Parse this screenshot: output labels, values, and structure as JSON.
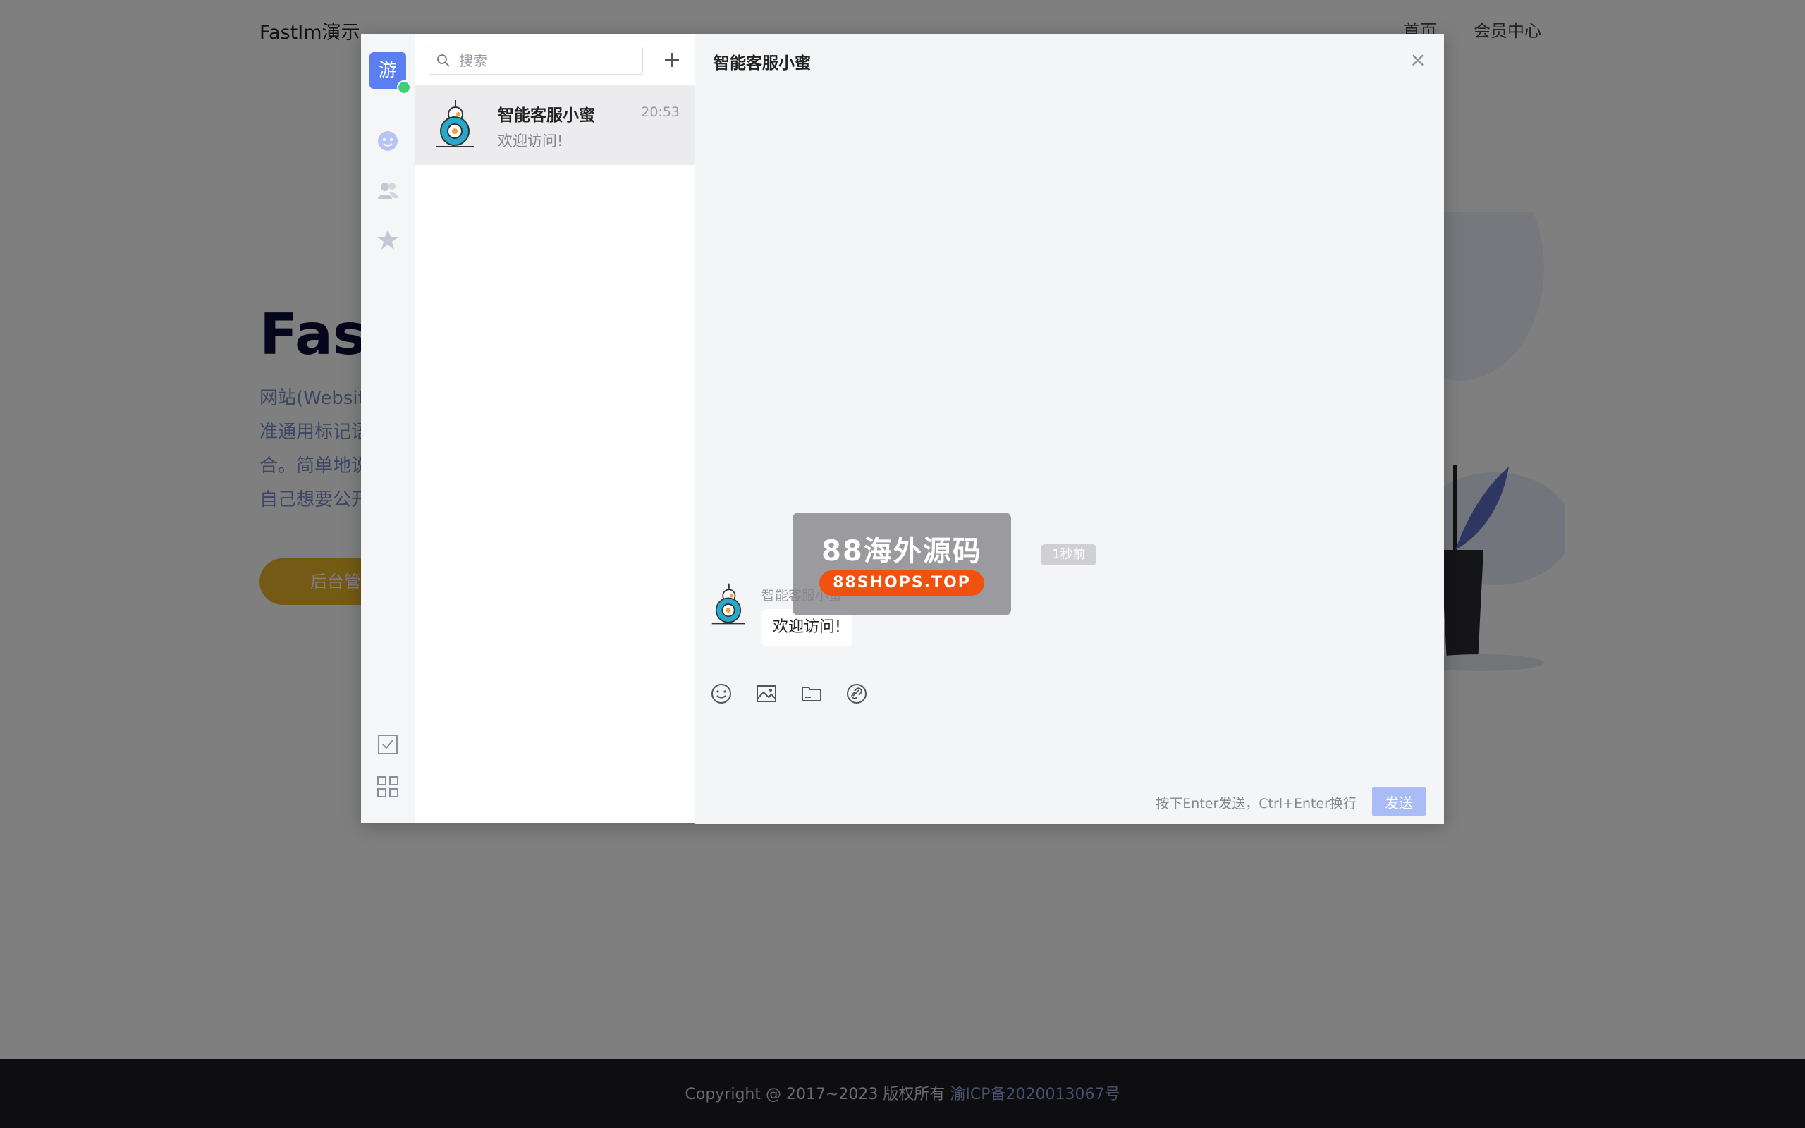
{
  "site": {
    "brand": "FastIm演示",
    "nav": [
      "首页",
      "会员中心"
    ],
    "hero_title": "Fast",
    "hero_lines": [
      "网站(Website",
      "准通用标记语",
      "合。简单地说",
      "自己想要公开"
    ],
    "hero_button": "后台管",
    "footer_text": "Copyright @ 2017~2023 版权所有",
    "footer_link": "渝ICP备2020013067号"
  },
  "colors": {
    "accent": "#5b7ef0",
    "online": "#3ad17a",
    "send_button": "#a9bcf5",
    "watermark_pill": "#f2500e"
  },
  "rail": {
    "me_avatar": "游",
    "icons": [
      "chat-icon",
      "contacts-icon",
      "favorites-icon",
      "tasks-icon",
      "apps-icon"
    ]
  },
  "conversations": {
    "search_placeholder": "搜索",
    "items": [
      {
        "name": "智能客服小蜜",
        "time": "20:53",
        "preview": "欢迎访问!"
      }
    ]
  },
  "chat": {
    "title": "智能客服小蜜",
    "close": "×",
    "time_badge": "1秒前",
    "messages": [
      {
        "sender": "智能客服小蜜",
        "text": "欢迎访问!"
      }
    ],
    "toolbar": [
      "emoji-icon",
      "image-icon",
      "folder-icon",
      "link-icon"
    ],
    "hint": "按下Enter发送，Ctrl+Enter换行",
    "send_label": "发送"
  },
  "watermark": {
    "title": "88海外源码",
    "pill": "88SHOPS.TOP"
  }
}
